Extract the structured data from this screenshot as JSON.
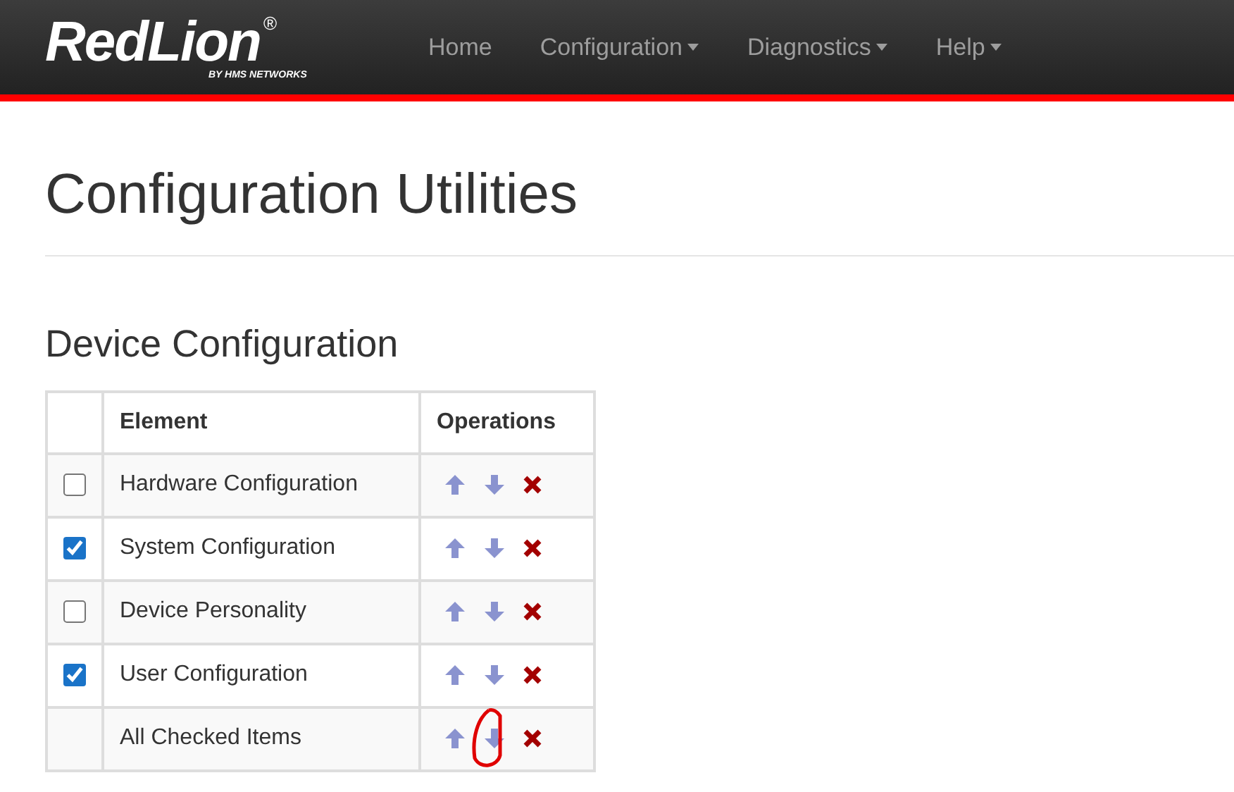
{
  "brand": {
    "name": "RedLion",
    "mark": "®",
    "tagline": "BY HMS NETWORKS"
  },
  "nav": [
    {
      "label": "Home",
      "dropdown": false
    },
    {
      "label": "Configuration",
      "dropdown": true
    },
    {
      "label": "Diagnostics",
      "dropdown": true
    },
    {
      "label": "Help",
      "dropdown": true
    }
  ],
  "page_title": "Configuration Utilities",
  "section_title": "Device Configuration",
  "table": {
    "columns": [
      "Element",
      "Operations"
    ],
    "rows": [
      {
        "kind": "item",
        "checked": false,
        "element": "Hardware Configuration"
      },
      {
        "kind": "item",
        "checked": true,
        "element": "System Configuration"
      },
      {
        "kind": "item",
        "checked": false,
        "element": "Device Personality"
      },
      {
        "kind": "item",
        "checked": true,
        "element": "User Configuration"
      },
      {
        "kind": "all",
        "element": "All Checked Items",
        "annotated": true
      }
    ]
  }
}
